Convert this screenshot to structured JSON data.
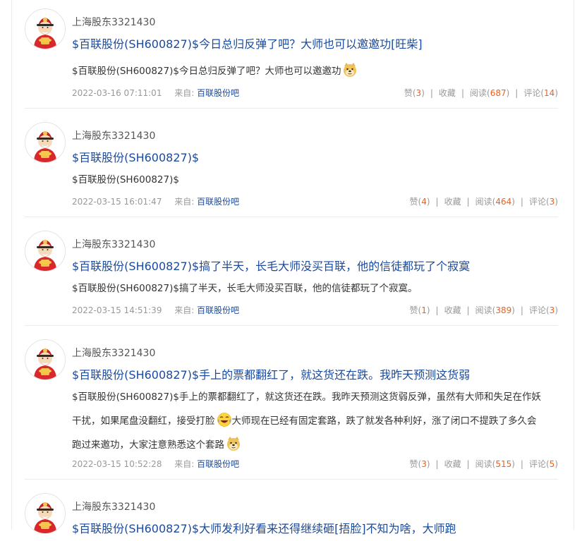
{
  "posts": [
    {
      "user": "上海股东3321430",
      "title": "$百联股份(SH600827)$今日总归反弹了吧？大师也可以邀邀功[旺柴]",
      "lines": [
        {
          "segments": [
            {
              "t": "$百联股份(SH600827)$今日总归反弹了吧？大师也可以邀邀功"
            },
            {
              "emoji": "doge"
            }
          ]
        }
      ],
      "date": "2022-03-16 07:11:01",
      "source_label": "来自:",
      "source": "百联股份吧",
      "like_label": "赞",
      "likes": "3",
      "fav_label": "收藏",
      "read_label": "阅读",
      "reads": "687",
      "comment_label": "评论",
      "comments": "14"
    },
    {
      "user": "上海股东3321430",
      "title": "$百联股份(SH600827)$",
      "lines": [
        {
          "segments": [
            {
              "t": "$百联股份(SH600827)$"
            }
          ]
        }
      ],
      "date": "2022-03-15 16:01:47",
      "source_label": "来自:",
      "source": "百联股份吧",
      "like_label": "赞",
      "likes": "4",
      "fav_label": "收藏",
      "read_label": "阅读",
      "reads": "464",
      "comment_label": "评论",
      "comments": "3"
    },
    {
      "user": "上海股东3321430",
      "title": "$百联股份(SH600827)$搞了半天，长毛大师没买百联，他的信徒都玩了个寂寞",
      "lines": [
        {
          "segments": [
            {
              "t": "$百联股份(SH600827)$搞了半天，长毛大师没买百联，他的信徒都玩了个寂寞。"
            }
          ]
        }
      ],
      "date": "2022-03-15 14:51:39",
      "source_label": "来自:",
      "source": "百联股份吧",
      "like_label": "赞",
      "likes": "1",
      "fav_label": "收藏",
      "read_label": "阅读",
      "reads": "389",
      "comment_label": "评论",
      "comments": "3"
    },
    {
      "user": "上海股东3321430",
      "title": "$百联股份(SH600827)$手上的票都翻红了，就这货还在跌。我昨天预测这货弱",
      "lines": [
        {
          "segments": [
            {
              "t": "$百联股份(SH600827)$手上的票都翻红了，就这货还在跌。我昨天预测这货弱反弹，虽然有大师和失足在作妖"
            }
          ]
        },
        {
          "segments": [
            {
              "t": "干扰，如果尾盘没翻红，接受打脸"
            },
            {
              "emoji": "laugh"
            },
            {
              "t": "大师现在已经有固定套路，跌了就发各种利好，涨了闭口不提跌了多久会"
            }
          ]
        },
        {
          "segments": [
            {
              "t": "跑过来邀功，大家注意熟悉这个套路"
            },
            {
              "emoji": "doge"
            }
          ]
        }
      ],
      "date": "2022-03-15 10:52:28",
      "source_label": "来自:",
      "source": "百联股份吧",
      "like_label": "赞",
      "likes": "3",
      "fav_label": "收藏",
      "read_label": "阅读",
      "reads": "515",
      "comment_label": "评论",
      "comments": "5"
    },
    {
      "user": "上海股东3321430",
      "title": "$百联股份(SH600827)$大师发利好看来还得继续砸[捂脸]不知为啥，大师跑",
      "lines": [],
      "date": "",
      "source_label": "",
      "source": "",
      "like_label": "",
      "likes": "",
      "fav_label": "",
      "read_label": "",
      "reads": "",
      "comment_label": "",
      "comments": ""
    }
  ]
}
